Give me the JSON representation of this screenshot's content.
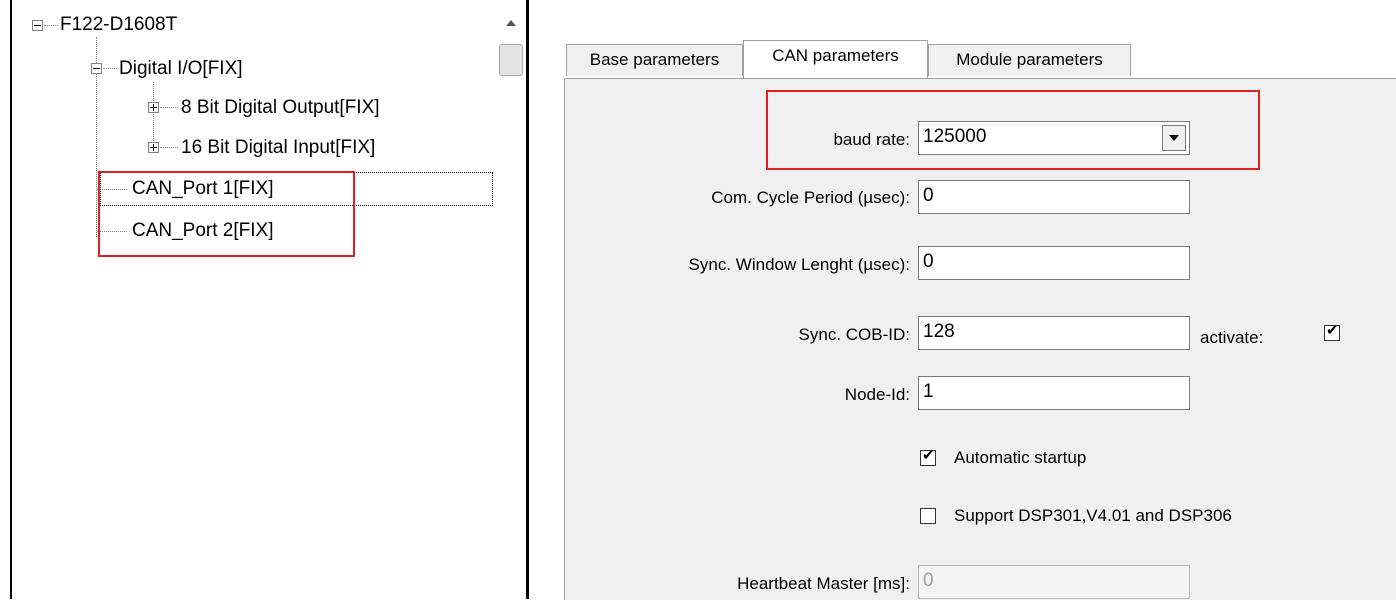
{
  "tree": {
    "root": "F122-D1608T",
    "digital_io": "Digital I/O[FIX]",
    "digital_output": "8 Bit Digital Output[FIX]",
    "digital_input": "16 Bit Digital Input[FIX]",
    "can_port_1": "CAN_Port 1[FIX]",
    "can_port_2": "CAN_Port 2[FIX]"
  },
  "tabs": {
    "base": "Base parameters",
    "can": "CAN parameters",
    "module": "Module parameters"
  },
  "form": {
    "baud_rate_label": "baud rate:",
    "baud_rate_value": "125000",
    "com_cycle_label": "Com. Cycle Period (µsec):",
    "com_cycle_value": "0",
    "sync_window_label": "Sync. Window Lenght (µsec):",
    "sync_window_value": "0",
    "sync_cob_label": "Sync. COB-ID:",
    "sync_cob_value": "128",
    "activate_label": "activate:",
    "activate_checked": true,
    "node_id_label": "Node-Id:",
    "node_id_value": "1",
    "auto_startup_label": "Automatic startup",
    "auto_startup_checked": true,
    "support_dsp_label": "Support DSP301,V4.01 and DSP306",
    "support_dsp_checked": false,
    "heartbeat_label": "Heartbeat Master [ms]:",
    "heartbeat_value": "0"
  },
  "colors": {
    "highlight": "#e02020",
    "panel": "#f0f0f0"
  }
}
